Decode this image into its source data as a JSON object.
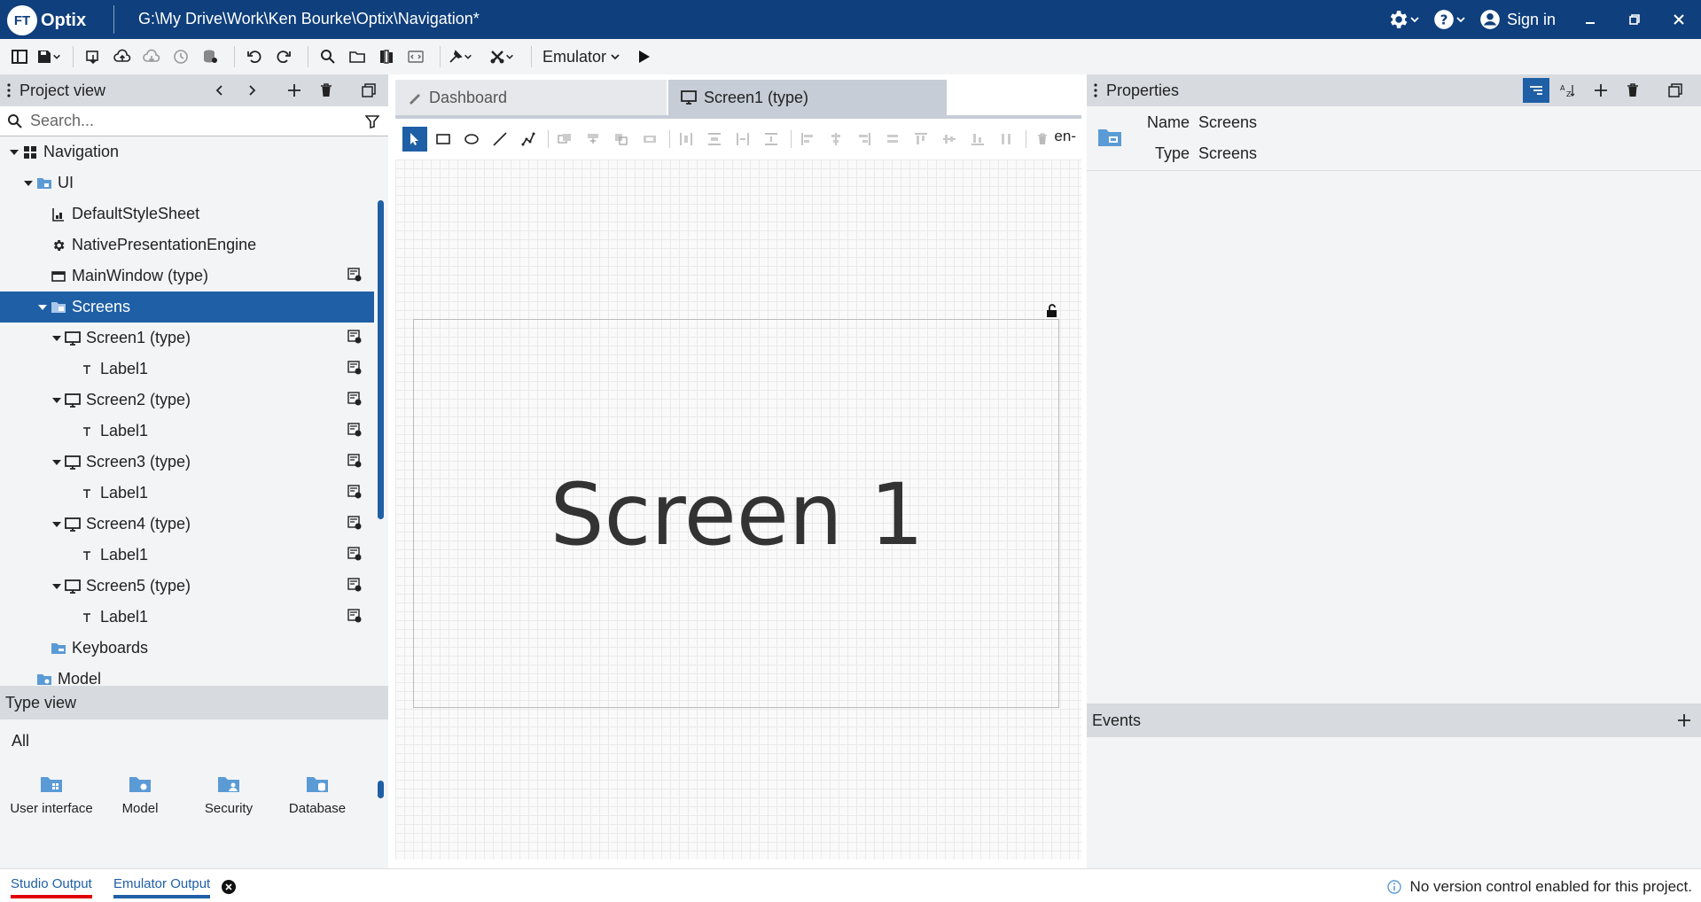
{
  "window": {
    "app_name": "Optix",
    "logo_text": "FT",
    "title": "G:\\My Drive\\Work\\Ken Bourke\\Optix\\Navigation*",
    "sign_in": "Sign in"
  },
  "toolbar": {
    "emulator_label": "Emulator"
  },
  "project_view": {
    "title": "Project view",
    "search_placeholder": "Search...",
    "tree": [
      {
        "label": "Navigation",
        "icon": "grid-icon"
      },
      {
        "label": "UI",
        "icon": "folder-icon"
      },
      {
        "label": "DefaultStyleSheet",
        "icon": "stylesheet-icon"
      },
      {
        "label": "NativePresentationEngine",
        "icon": "gear-icon"
      },
      {
        "label": "MainWindow (type)",
        "icon": "window-icon"
      },
      {
        "label": "Screens",
        "icon": "folder-icon"
      },
      {
        "label": "Screen1 (type)",
        "icon": "monitor-icon"
      },
      {
        "label": "Label1",
        "icon": "text-icon"
      },
      {
        "label": "Screen2 (type)",
        "icon": "monitor-icon"
      },
      {
        "label": "Label1",
        "icon": "text-icon"
      },
      {
        "label": "Screen3 (type)",
        "icon": "monitor-icon"
      },
      {
        "label": "Label1",
        "icon": "text-icon"
      },
      {
        "label": "Screen4 (type)",
        "icon": "monitor-icon"
      },
      {
        "label": "Label1",
        "icon": "text-icon"
      },
      {
        "label": "Screen5 (type)",
        "icon": "monitor-icon"
      },
      {
        "label": "Label1",
        "icon": "text-icon"
      },
      {
        "label": "Keyboards",
        "icon": "folder-icon"
      },
      {
        "label": "Model",
        "icon": "folder-icon"
      }
    ]
  },
  "type_view": {
    "title": "Type view",
    "filter": "All",
    "items": [
      {
        "label": "User interface"
      },
      {
        "label": "Model"
      },
      {
        "label": "Security"
      },
      {
        "label": "Database"
      }
    ]
  },
  "editor": {
    "tabs": [
      {
        "label": "Dashboard"
      },
      {
        "label": "Screen1 (type)"
      }
    ],
    "locale": "en-",
    "screen_text": "Screen 1"
  },
  "properties": {
    "title": "Properties",
    "name_label": "Name",
    "name_value": "Screens",
    "type_label": "Type",
    "type_value": "Screens"
  },
  "events": {
    "title": "Events"
  },
  "status": {
    "tab1": "Studio Output",
    "tab2": "Emulator Output",
    "message": "No version control enabled for this project."
  },
  "colors": {
    "titlebar": "#0f3f7c",
    "selection": "#1f5fa5",
    "icon_folder": "#5b9bd5"
  }
}
